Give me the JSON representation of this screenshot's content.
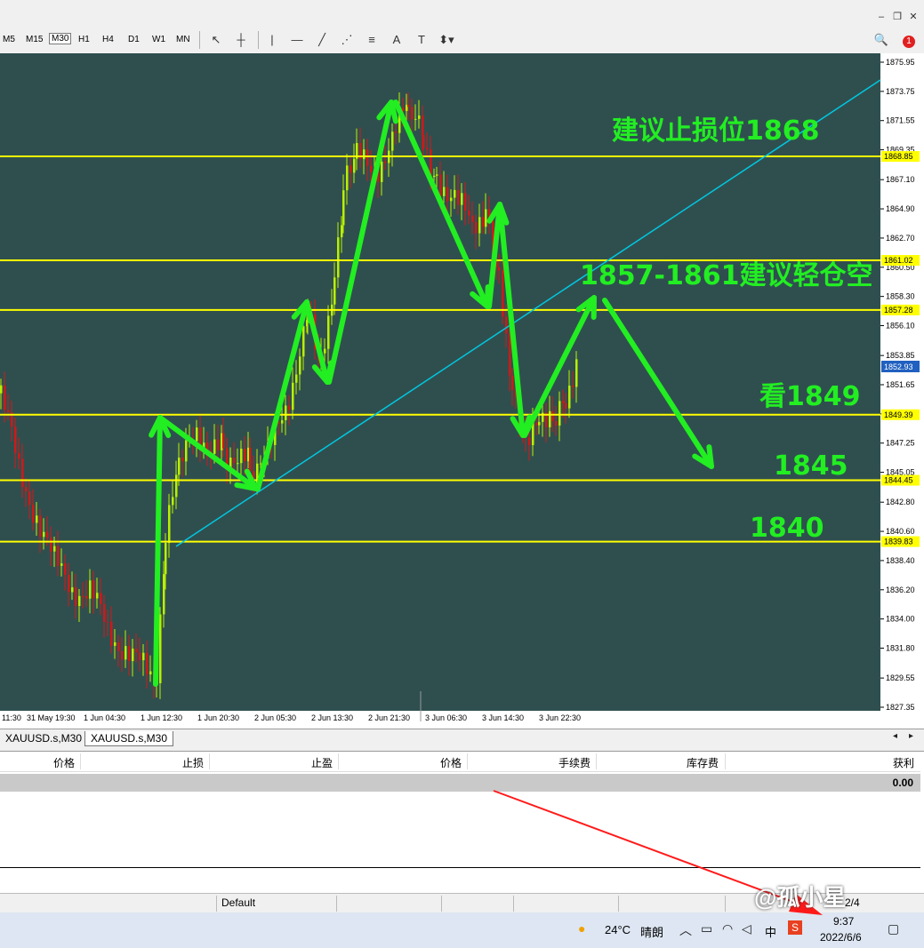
{
  "toolbar": {
    "timeframes": [
      "M5",
      "M15",
      "M30",
      "H1",
      "H4",
      "D1",
      "W1",
      "MN"
    ],
    "active_timeframe": "M30",
    "notification_count": "1"
  },
  "chart": {
    "symbol": "XAUUSD.s,M30",
    "price_ticks": [
      "1875.95",
      "1873.75",
      "1871.55",
      "1869.35",
      "1867.10",
      "1864.90",
      "1862.70",
      "1860.50",
      "1858.30",
      "1856.10",
      "1853.85",
      "1851.65",
      "1849.45",
      "1847.25",
      "1845.05",
      "1842.80",
      "1840.60",
      "1838.40",
      "1836.20",
      "1834.00",
      "1831.80",
      "1829.55",
      "1827.35"
    ],
    "time_labels": [
      "11:30",
      "31 May 19:30",
      "1 Jun 04:30",
      "1 Jun 12:30",
      "1 Jun 20:30",
      "2 Jun 05:30",
      "2 Jun 13:30",
      "2 Jun 21:30",
      "3 Jun 06:30",
      "3 Jun 14:30",
      "3 Jun 22:30"
    ],
    "levels": [
      {
        "price": 1868.85,
        "label": "1868.85"
      },
      {
        "price": 1861.02,
        "label": "1861.02"
      },
      {
        "price": 1857.28,
        "label": "1857.28"
      },
      {
        "price": 1849.39,
        "label": "1849.39"
      },
      {
        "price": 1844.45,
        "label": "1844.45"
      },
      {
        "price": 1839.83,
        "label": "1839.83"
      }
    ],
    "current_price": "1852.93",
    "annotations": {
      "stop_loss": "建议止损位1868",
      "short_zone": "1857-1861建议轻仓空",
      "target1": "看1849",
      "target2": "1845",
      "target3": "1840"
    },
    "colors": {
      "background": "#2f4f4f",
      "level_line": "#ffff00",
      "trend_line": "#00c8e0",
      "bull_candle": "#b8f000",
      "bear_candle": "#d01818",
      "arrow": "#22ee22"
    }
  },
  "tabs": [
    "XAUUSD.s,M30",
    "XAUUSD.s,M30"
  ],
  "terminal": {
    "columns": [
      "价格",
      "止损",
      "止盈",
      "价格",
      "手续费",
      "库存费",
      "获利"
    ],
    "total_profit": "0.00"
  },
  "statusbar": {
    "profile": "Default",
    "extra": "2/4"
  },
  "taskbar": {
    "weather_temp": "24°C",
    "weather_desc": "晴朗",
    "ime": "中",
    "time": "9:37",
    "date": "2022/6/6"
  },
  "watermark": "@孤小星"
}
